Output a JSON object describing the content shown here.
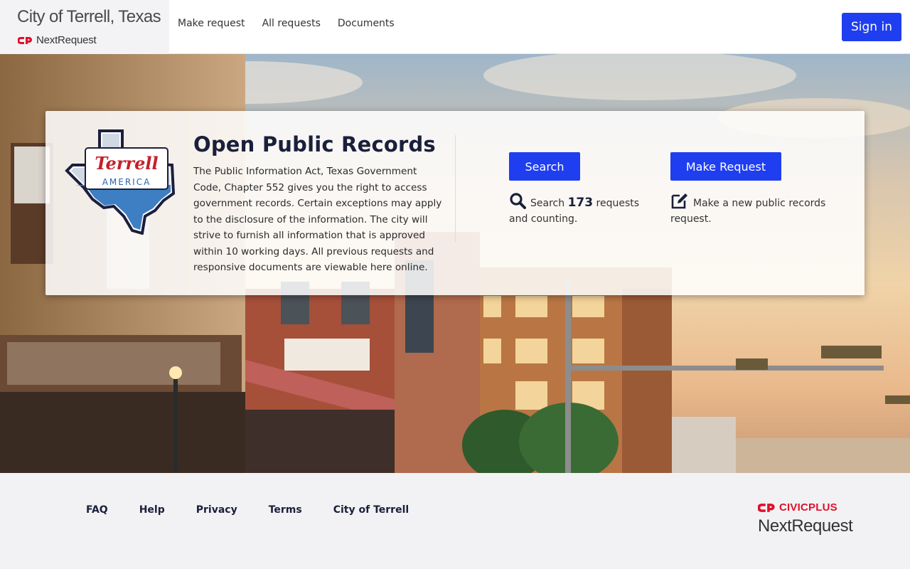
{
  "header": {
    "brand_title": "City of Terrell, Texas",
    "brand_sub": "NextRequest",
    "nav": [
      "Make request",
      "All requests",
      "Documents"
    ],
    "signin_label": "Sign in"
  },
  "card": {
    "logo_text": "Terrell",
    "logo_subtext": "AMERICA",
    "title": "Open Public Records",
    "body": "The Public Information Act, Texas Government Code, Chapter 552 gives you the right to access government records. Certain exceptions may apply to the disclosure of the information. The city will strive to furnish all information that is approved within 10 working days.  All previous requests and responsive documents are viewable here online.",
    "search_button": "Search",
    "search_pre": "Search",
    "search_count": "173",
    "search_post": "requests and counting.",
    "make_button": "Make Request",
    "make_info": "Make a new public records request."
  },
  "footer": {
    "links": [
      "FAQ",
      "Help",
      "Privacy",
      "Terms",
      "City of Terrell"
    ],
    "civic_name": "CIVICPLUS",
    "civic_product": "NextRequest"
  },
  "colors": {
    "primary": "#1f3ef0",
    "dark_text": "#1a1f3a",
    "civic_red": "#e0102a",
    "footer_bg": "#f2f2f4"
  },
  "icons": [
    "civicplus-logo-icon",
    "terrell-texas-logo-icon",
    "search-icon",
    "edit-icon"
  ]
}
